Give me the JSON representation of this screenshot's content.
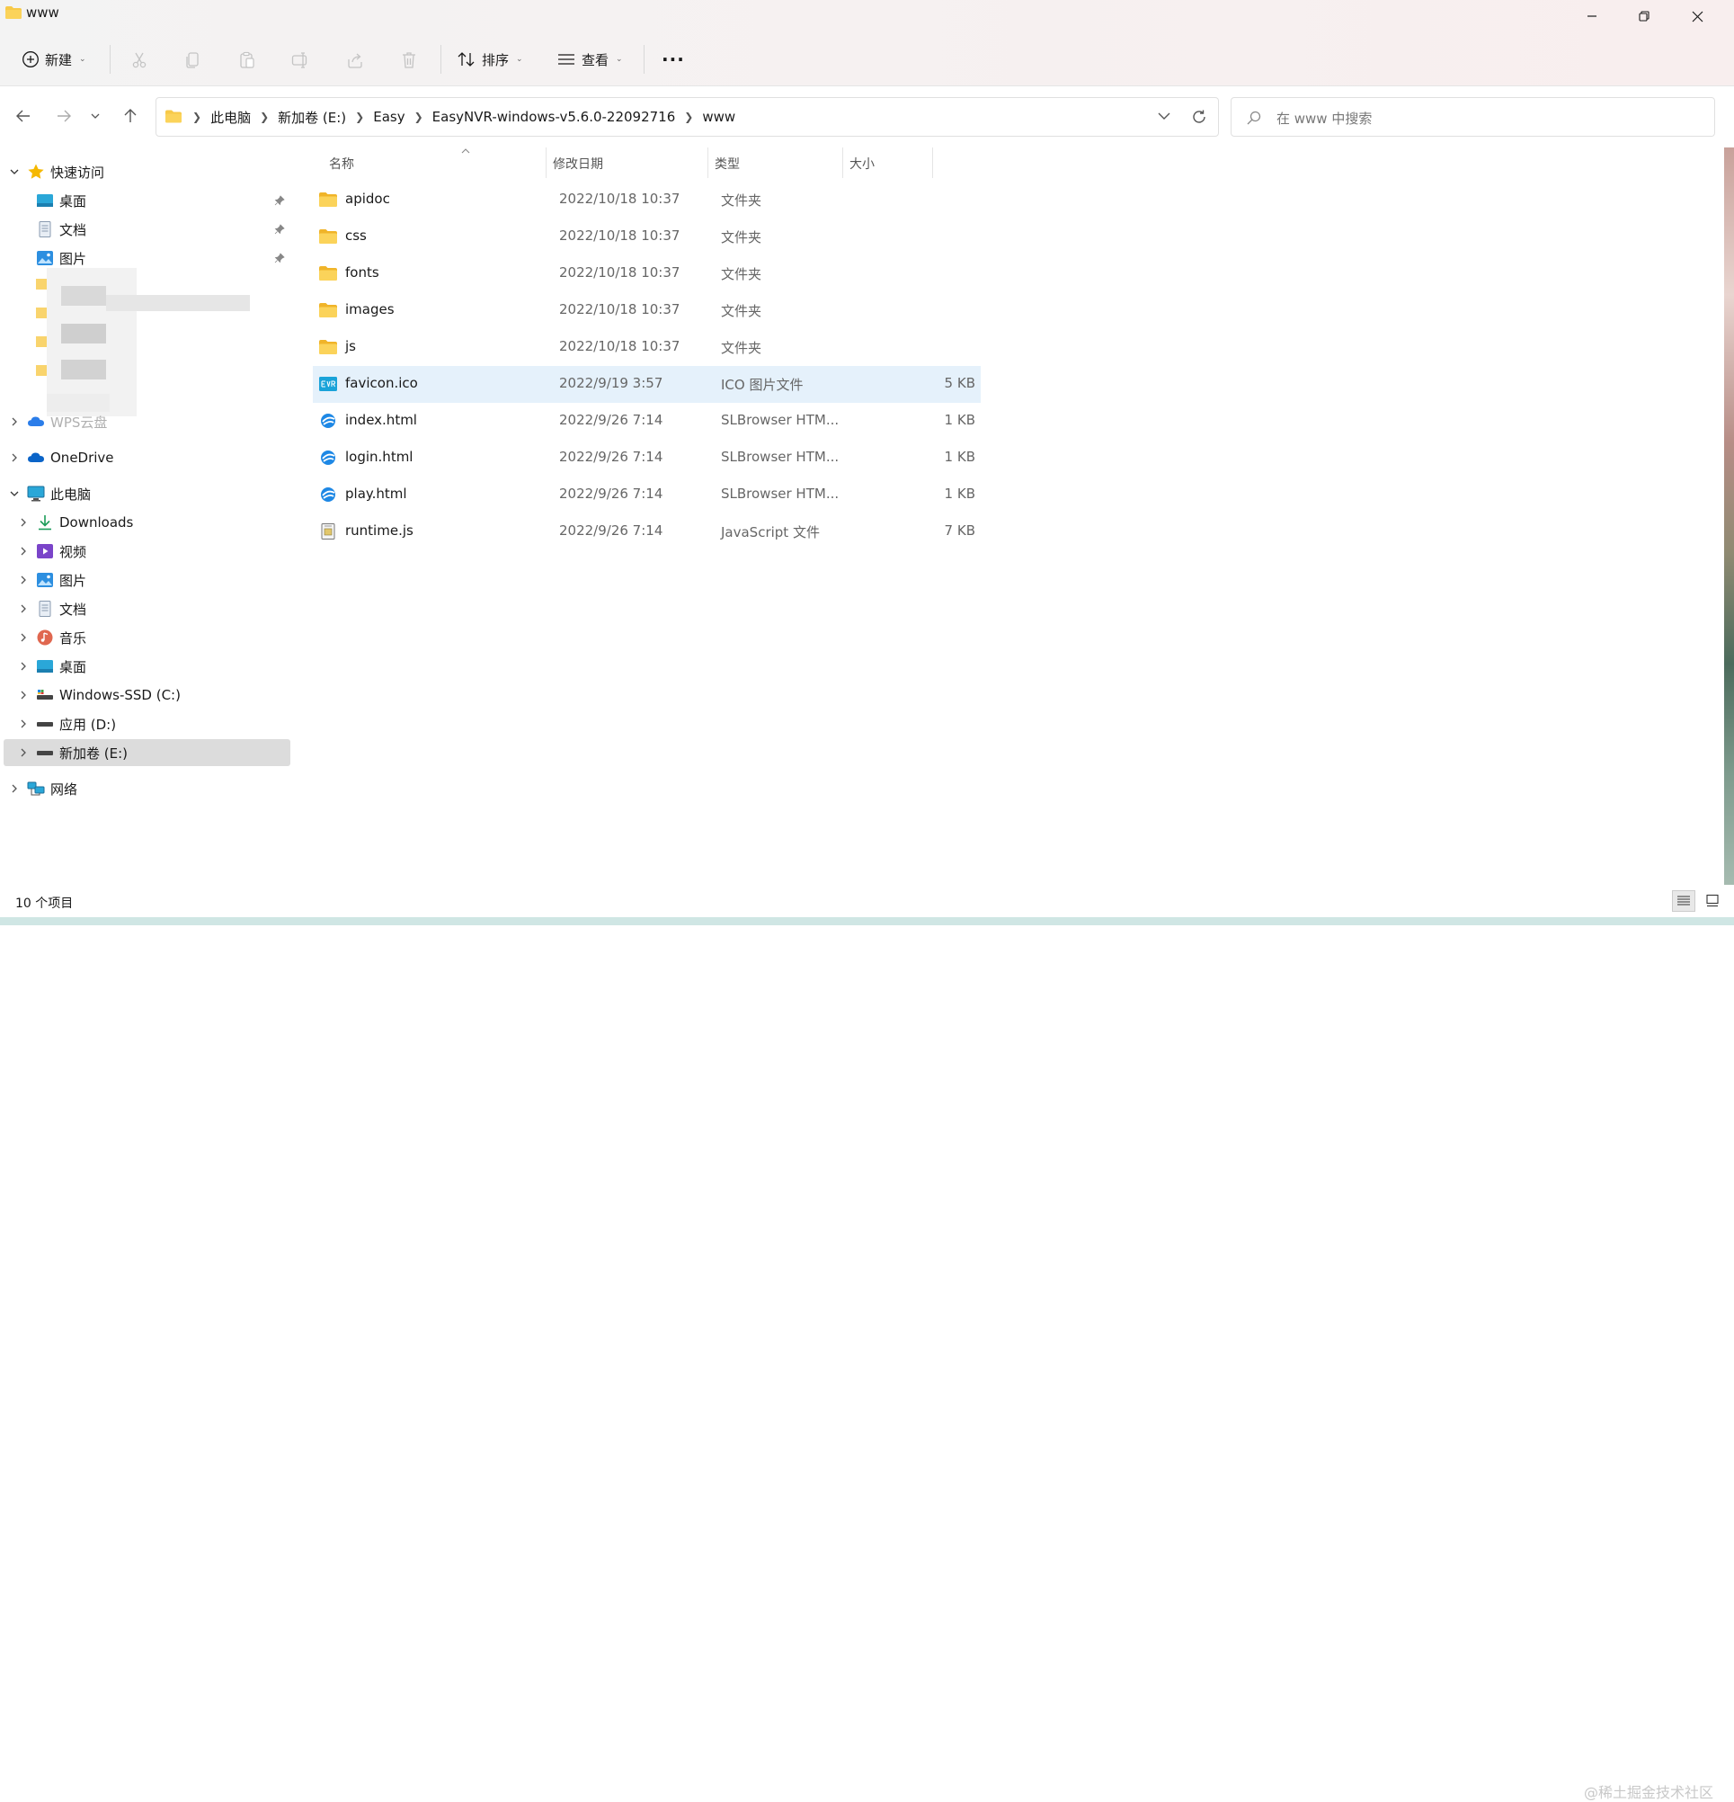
{
  "window": {
    "title": "www"
  },
  "toolbar": {
    "new_label": "新建",
    "sort_label": "排序",
    "view_label": "查看",
    "more_label": "···"
  },
  "address": {
    "crumbs": [
      "此电脑",
      "新加卷 (E:)",
      "Easy",
      "EasyNVR-windows-v5.6.0-22092716",
      "www"
    ]
  },
  "search": {
    "placeholder": "在 www 中搜索"
  },
  "sidebar": {
    "quick_access": "快速访问",
    "pinned": [
      {
        "label": "桌面",
        "icon": "desktop-icon"
      },
      {
        "label": "文档",
        "icon": "document-icon"
      },
      {
        "label": "图片",
        "icon": "pictures-icon"
      }
    ],
    "wps": "WPS云盘",
    "onedrive": "OneDrive",
    "this_pc": "此电脑",
    "pc_items": [
      {
        "label": "Downloads",
        "icon": "download-icon"
      },
      {
        "label": "视频",
        "icon": "video-icon"
      },
      {
        "label": "图片",
        "icon": "pictures-icon"
      },
      {
        "label": "文档",
        "icon": "document-icon"
      },
      {
        "label": "音乐",
        "icon": "music-icon"
      },
      {
        "label": "桌面",
        "icon": "desktop-icon"
      },
      {
        "label": "Windows-SSD (C:)",
        "icon": "drive-icon"
      },
      {
        "label": "应用 (D:)",
        "icon": "drive-icon"
      },
      {
        "label": "新加卷 (E:)",
        "icon": "drive-icon"
      }
    ],
    "network": "网络"
  },
  "columns": {
    "name": "名称",
    "date": "修改日期",
    "type": "类型",
    "size": "大小"
  },
  "files": [
    {
      "name": "apidoc",
      "date": "2022/10/18 10:37",
      "type": "文件夹",
      "size": "",
      "icon": "folder-icon"
    },
    {
      "name": "css",
      "date": "2022/10/18 10:37",
      "type": "文件夹",
      "size": "",
      "icon": "folder-icon"
    },
    {
      "name": "fonts",
      "date": "2022/10/18 10:37",
      "type": "文件夹",
      "size": "",
      "icon": "folder-icon"
    },
    {
      "name": "images",
      "date": "2022/10/18 10:37",
      "type": "文件夹",
      "size": "",
      "icon": "folder-icon"
    },
    {
      "name": "js",
      "date": "2022/10/18 10:37",
      "type": "文件夹",
      "size": "",
      "icon": "folder-icon"
    },
    {
      "name": "favicon.ico",
      "date": "2022/9/19 3:57",
      "type": "ICO 图片文件",
      "size": "5 KB",
      "icon": "ico-file-icon"
    },
    {
      "name": "index.html",
      "date": "2022/9/26 7:14",
      "type": "SLBrowser HTM...",
      "size": "1 KB",
      "icon": "browser-file-icon"
    },
    {
      "name": "login.html",
      "date": "2022/9/26 7:14",
      "type": "SLBrowser HTM...",
      "size": "1 KB",
      "icon": "browser-file-icon"
    },
    {
      "name": "play.html",
      "date": "2022/9/26 7:14",
      "type": "SLBrowser HTM...",
      "size": "1 KB",
      "icon": "browser-file-icon"
    },
    {
      "name": "runtime.js",
      "date": "2022/9/26 7:14",
      "type": "JavaScript 文件",
      "size": "7 KB",
      "icon": "js-file-icon"
    }
  ],
  "status": {
    "count": "10 个项目"
  },
  "watermark": "@稀土掘金技术社区",
  "colors": {
    "folder": "#f7c948",
    "selection": "#e5f1fb",
    "accent": "#0067c0"
  }
}
